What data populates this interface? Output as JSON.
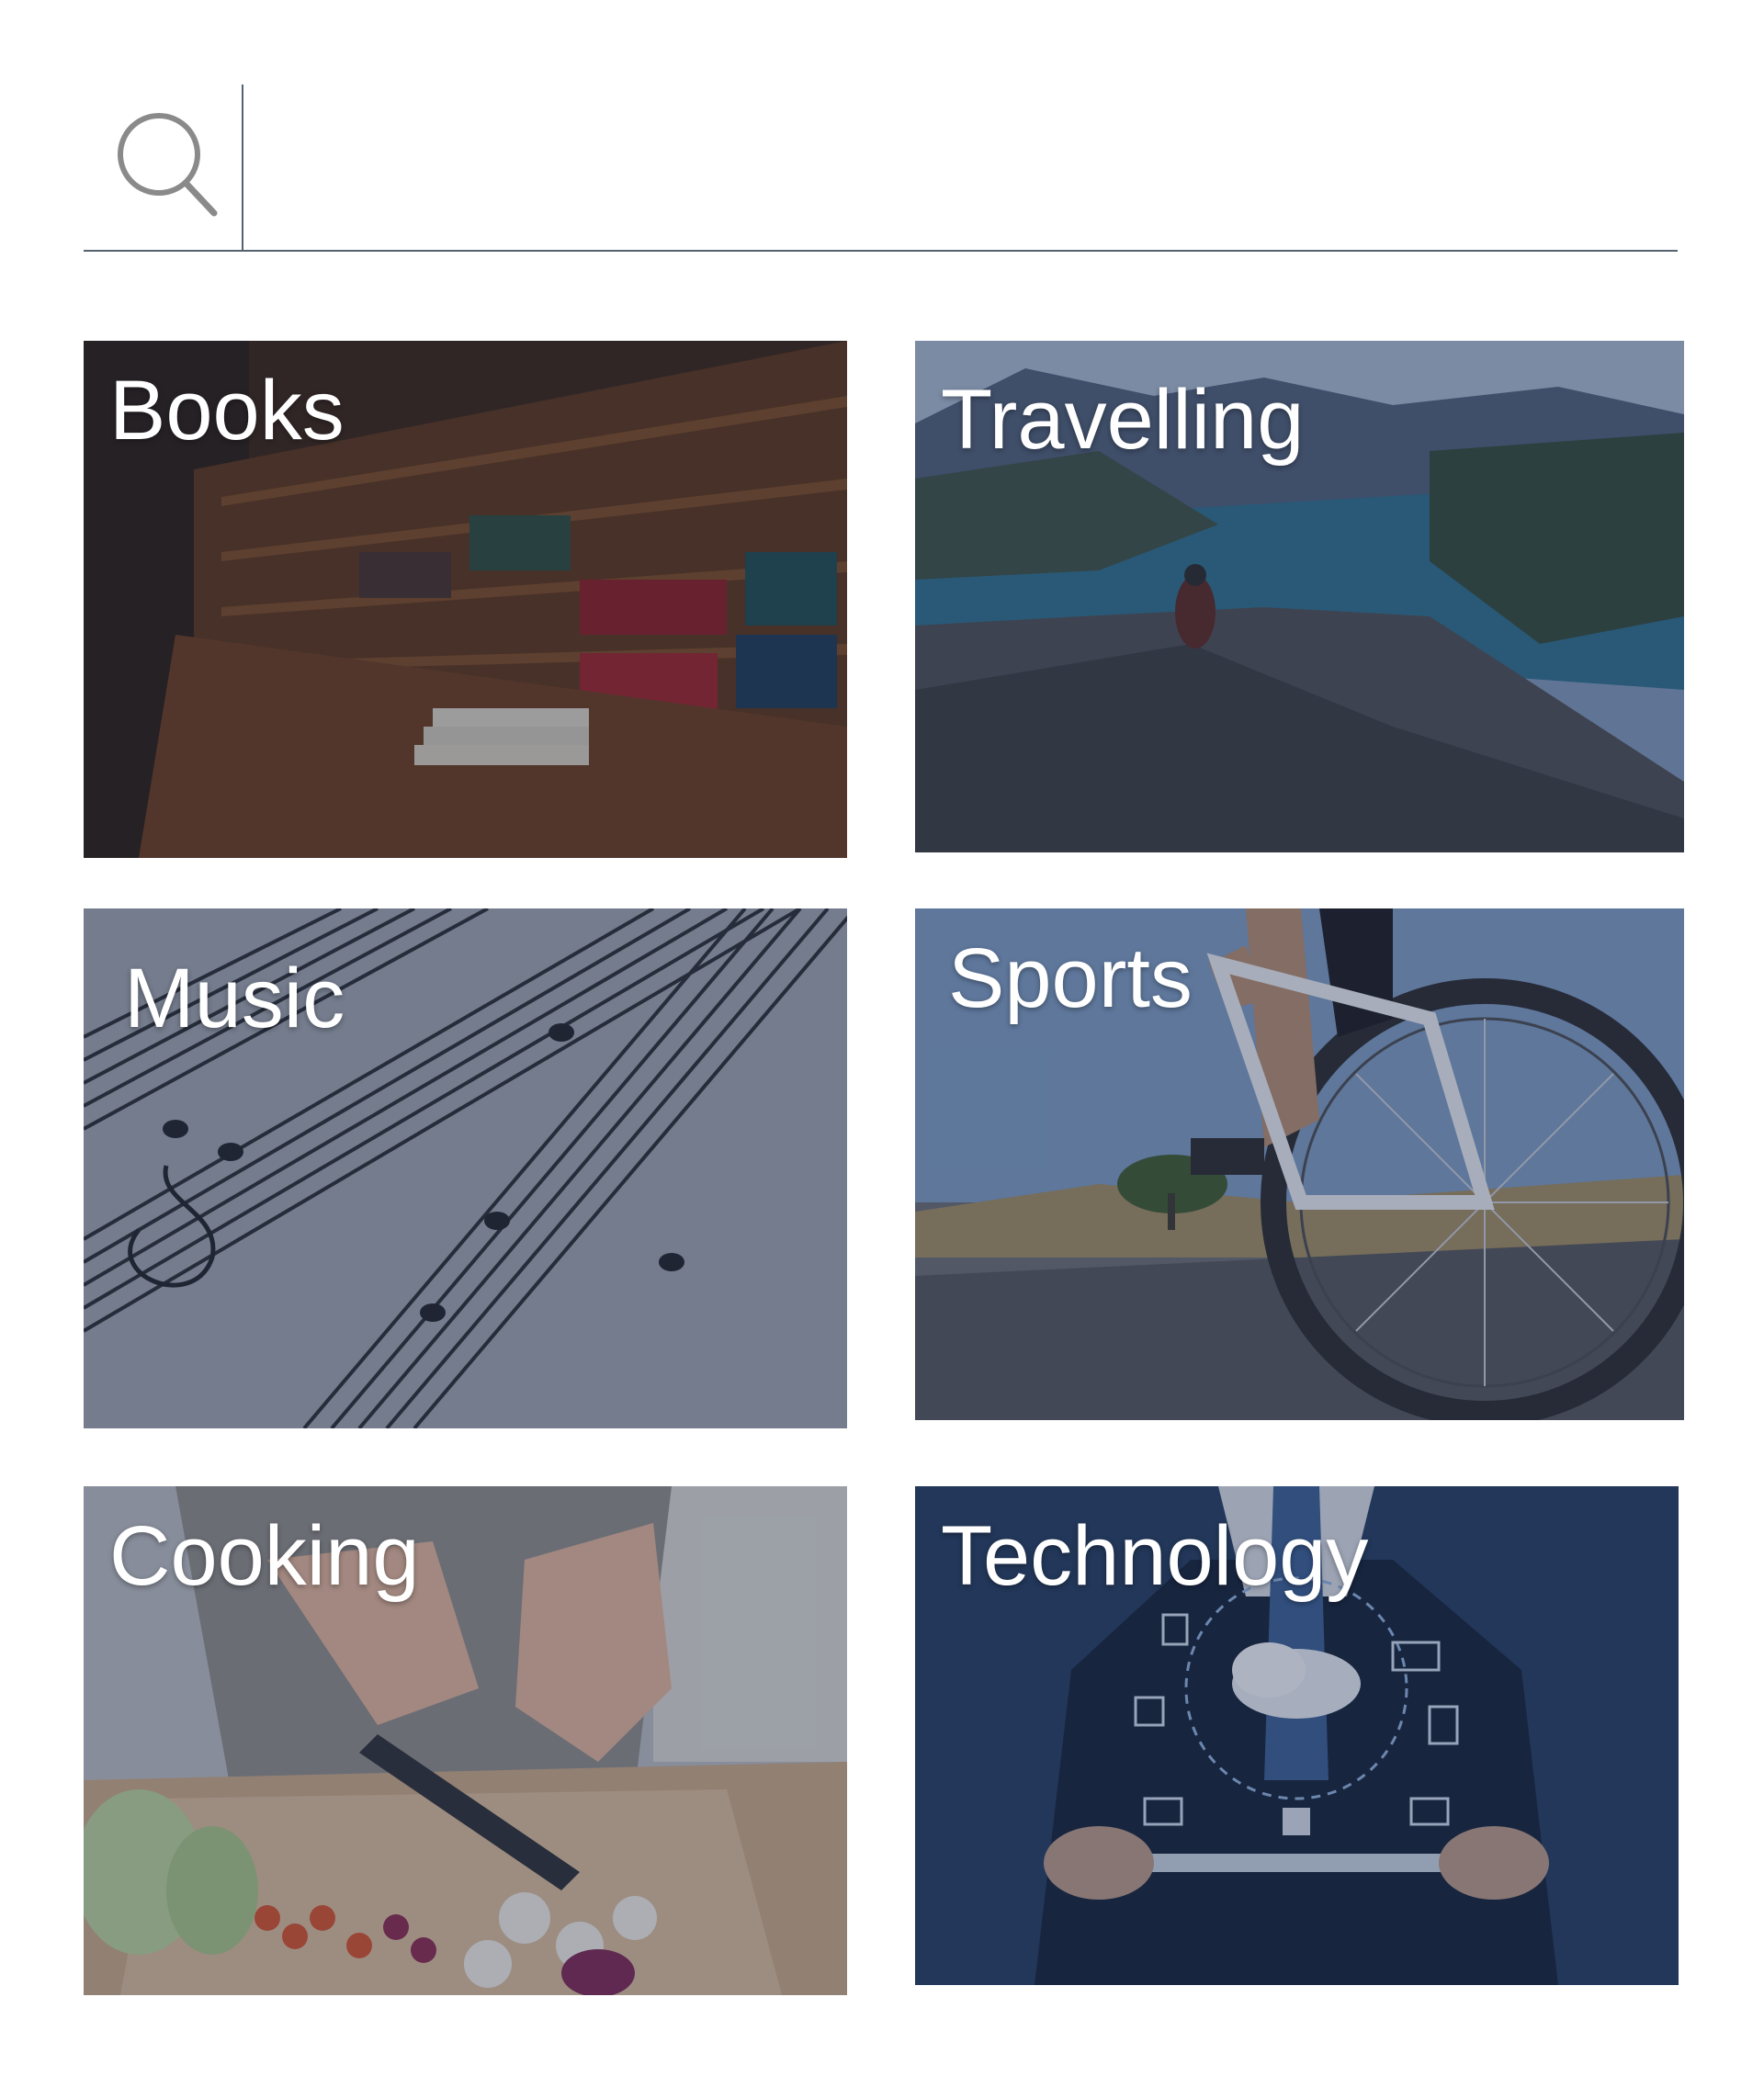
{
  "search": {
    "placeholder": "",
    "value": "",
    "icon": "search-icon"
  },
  "categories": [
    {
      "id": "books",
      "label": "Books"
    },
    {
      "id": "travelling",
      "label": "Travelling"
    },
    {
      "id": "music",
      "label": "Music"
    },
    {
      "id": "sports",
      "label": "Sports"
    },
    {
      "id": "cooking",
      "label": "Cooking"
    },
    {
      "id": "technology",
      "label": "Technology"
    }
  ],
  "colors": {
    "search_line": "#55626f",
    "tile_overlay": "#1e2d4b",
    "label_text": "#ffffff"
  }
}
